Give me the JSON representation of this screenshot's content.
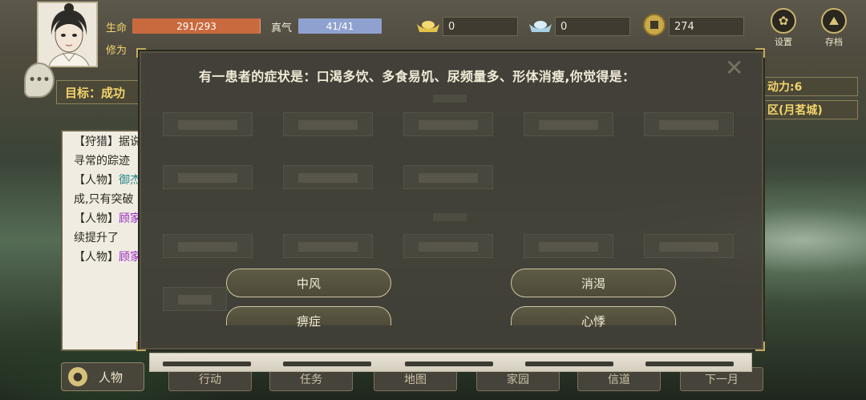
{
  "player": {
    "hp_label": "生命",
    "hp_value": "291/293",
    "hp_fraction": 0.993,
    "qi_label": "真气",
    "qi_value": "41/41",
    "qi_fraction": 1.0,
    "cultivation_label": "修为"
  },
  "resources": {
    "gold": "0",
    "silver": "0",
    "coins": "274"
  },
  "top_buttons": {
    "settings": "设置",
    "save": "存档"
  },
  "goal": {
    "label": "目标：成功"
  },
  "right_panel": {
    "action_points": "动力:6",
    "location": "区(月茗城)"
  },
  "log": {
    "lines": [
      {
        "tag": "【狩猎】",
        "text": "据说",
        "accent": ""
      },
      {
        "tag": "",
        "text": "寻常的踪迹",
        "accent": ""
      },
      {
        "tag": "【人物】",
        "text": "",
        "accent": "御杰"
      },
      {
        "tag": "",
        "text": "成,只有突破",
        "accent": ""
      },
      {
        "tag": "【人物】",
        "text": "",
        "accent": "顾家"
      },
      {
        "tag": "",
        "text": "续提升了",
        "accent": ""
      },
      {
        "tag": "【人物】",
        "text": "",
        "accent": "顾家"
      }
    ]
  },
  "quiz": {
    "question": "有一患者的症状是：口渴多饮、多食易饥、尿频量多、形体消瘦,你觉得是：",
    "options": [
      "中风",
      "消渴",
      "痹症",
      "心悸"
    ]
  },
  "bottom_nav": {
    "character": "人物",
    "action": "行动",
    "task": "任务",
    "map": "地图",
    "home": "家园",
    "mail": "信道",
    "next_month": "下一月"
  },
  "colors": {
    "hp": "#c96a3e",
    "qi": "#8fa2cf",
    "accent_gold": "#f2d46b"
  }
}
